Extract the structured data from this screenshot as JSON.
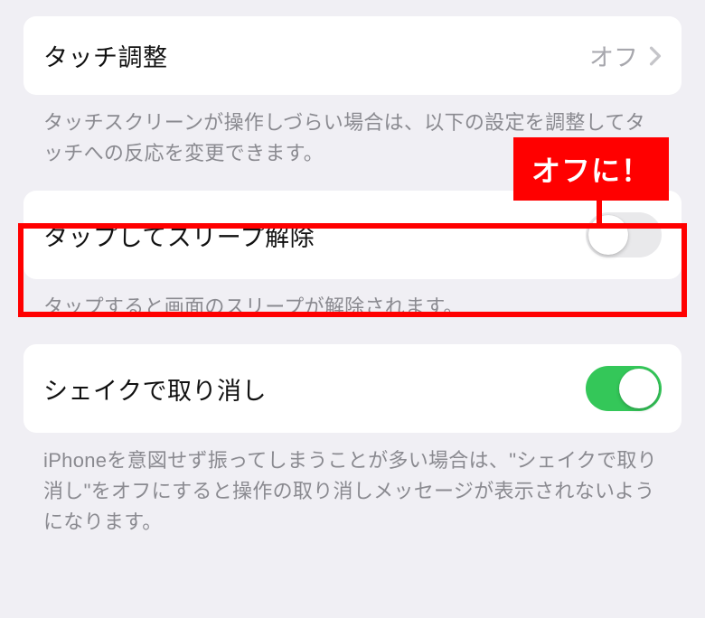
{
  "rows": {
    "touch_accommodations": {
      "title": "タッチ調整",
      "value": "オフ",
      "footer": "タッチスクリーンが操作しづらい場合は、以下の設定を調整してタッチへの反応を変更できます。"
    },
    "tap_to_wake": {
      "title": "タップしてスリープ解除",
      "footer": "タップすると画面のスリープが解除されます。",
      "toggle_on": false
    },
    "shake_to_undo": {
      "title": "シェイクで取り消し",
      "footer": "iPhoneを意図せず振ってしまうことが多い場合は、\"シェイクで取り消し\"をオフにすると操作の取り消しメッセージが表示されないようになります。",
      "toggle_on": true
    }
  },
  "annotation": {
    "callout_text": "オフに！",
    "highlight_color": "#ff0000"
  }
}
